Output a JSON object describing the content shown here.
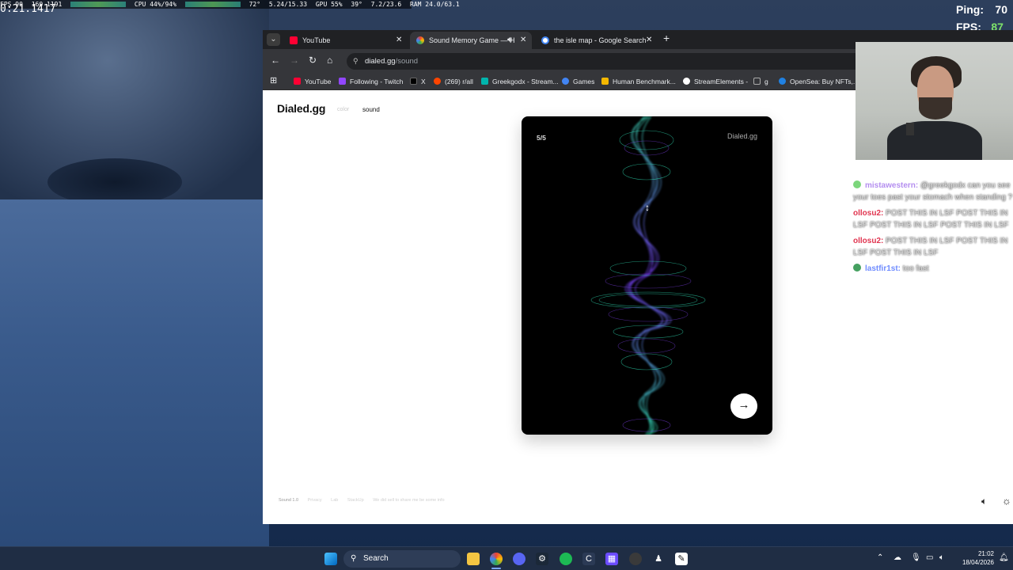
{
  "overlay": {
    "timer": "0:21.1417",
    "fps_stat": "FPS 90",
    "frame_stat": "160 1191",
    "cpu": "CPU 44%/94%",
    "cpu_temp": "72°",
    "net": "5.24/15.33",
    "gpu": "GPU 55%",
    "gpu_temp": "39°",
    "vram": "7.2/23.6",
    "ram": "RAM 24.0/63.1",
    "ping_label": "Ping:",
    "ping_value": "70",
    "fps_label": "FPS:",
    "fps_value": "87"
  },
  "browser": {
    "tabs": [
      {
        "title": "YouTube",
        "icon": "youtube-icon",
        "color": "#ff0033",
        "active": false
      },
      {
        "title": "Sound Memory Game — H",
        "icon": "chrome-icon",
        "color": "#8a7dff",
        "active": true
      },
      {
        "title": "the isle map - Google Search",
        "icon": "google-icon",
        "color": "#4285f4",
        "active": false
      }
    ],
    "url_host": "dialed.gg",
    "url_path": "/sound",
    "bookmarks": [
      {
        "label": "YouTube",
        "color": "#ff0033"
      },
      {
        "label": "Following - Twitch",
        "color": "#9146ff"
      },
      {
        "label": "X",
        "color": "#000000"
      },
      {
        "label": "(269) r/all",
        "color": "#ff4500"
      },
      {
        "label": "Greekgodx - Stream...",
        "color": "#00b5ad"
      },
      {
        "label": "Games",
        "color": "#4285f4"
      },
      {
        "label": "Human Benchmark...",
        "color": "#f5b800"
      },
      {
        "label": "StreamElements -",
        "color": "#ffffff"
      },
      {
        "label": "g",
        "color": "#aaaaaa"
      },
      {
        "label": "OpenSea: Buy NFTs,...",
        "color": "#2081e2"
      }
    ]
  },
  "site": {
    "logo": "Dialed.gg",
    "mode_color": "color",
    "mode_sound": "sound",
    "card": {
      "round": "5/5",
      "brand": "Dialed.gg",
      "next_icon": "arrow-right-icon"
    },
    "footer": {
      "version": "Sound 1.0",
      "links": [
        "Privacy",
        "Lab",
        "StackUp",
        "We did sell to share me be some info"
      ]
    }
  },
  "chat": [
    {
      "user": "mistawestern:",
      "text": "@greekgodx can you see your toes past your stomach when standing ?",
      "color": "#b48ef0",
      "badge": "#7cd67c"
    },
    {
      "user": "ollosu2:",
      "text": "POST THIS IN LSF POST THIS IN LSF POST THIS IN LSF POST THIS IN LSF",
      "color": "#e0344f",
      "badge": ""
    },
    {
      "user": "ollosu2:",
      "text": "POST THIS IN LSF POST THIS IN LSF POST THIS IN LSF",
      "color": "#e0344f",
      "badge": ""
    },
    {
      "user": "lastfir1st:",
      "text": "too fast",
      "color": "#6f8cff",
      "badge": "#45a060"
    }
  ],
  "taskbar": {
    "search_label": "Search",
    "time": "21:02",
    "date": "18/04/2026"
  }
}
